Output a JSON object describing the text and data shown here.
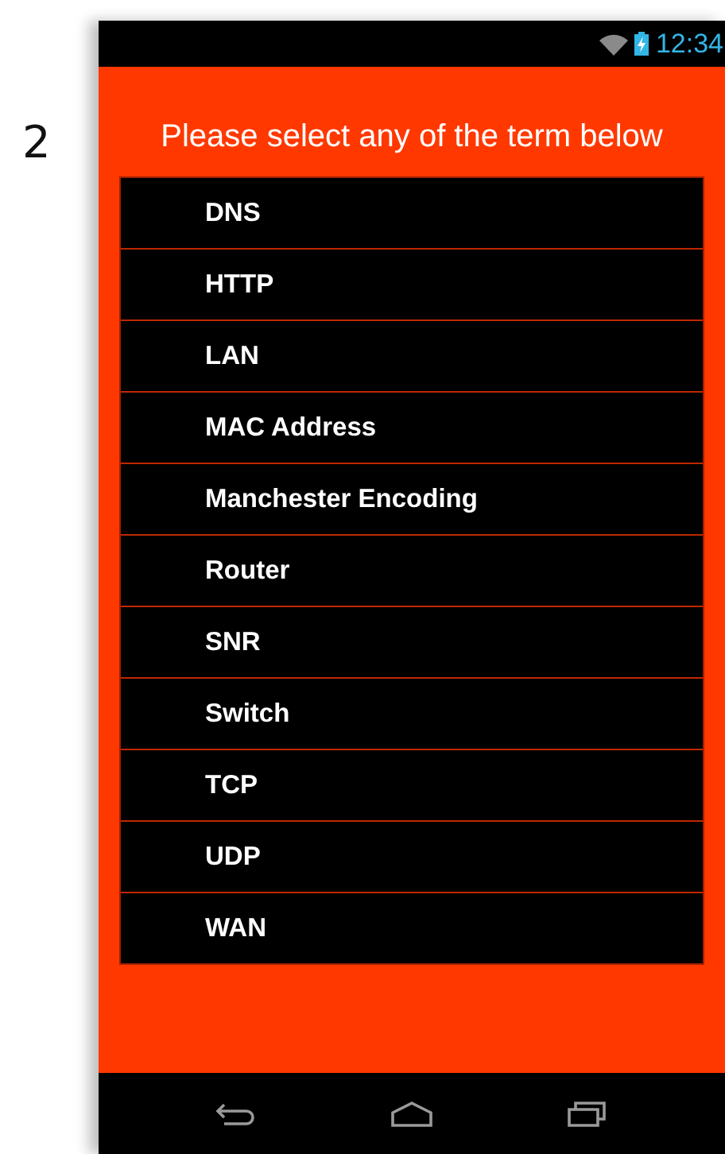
{
  "page_number": "2",
  "status_bar": {
    "time": "12:34"
  },
  "title": "Please select any of the term below",
  "terms": [
    {
      "label": "DNS"
    },
    {
      "label": "HTTP"
    },
    {
      "label": "LAN"
    },
    {
      "label": "MAC Address"
    },
    {
      "label": "Manchester Encoding"
    },
    {
      "label": "Router"
    },
    {
      "label": "SNR"
    },
    {
      "label": "Switch"
    },
    {
      "label": "TCP"
    },
    {
      "label": "UDP"
    },
    {
      "label": "WAN"
    }
  ],
  "nav_bar": [
    {
      "kind": "back"
    },
    {
      "kind": "home"
    },
    {
      "kind": "recents"
    }
  ]
}
